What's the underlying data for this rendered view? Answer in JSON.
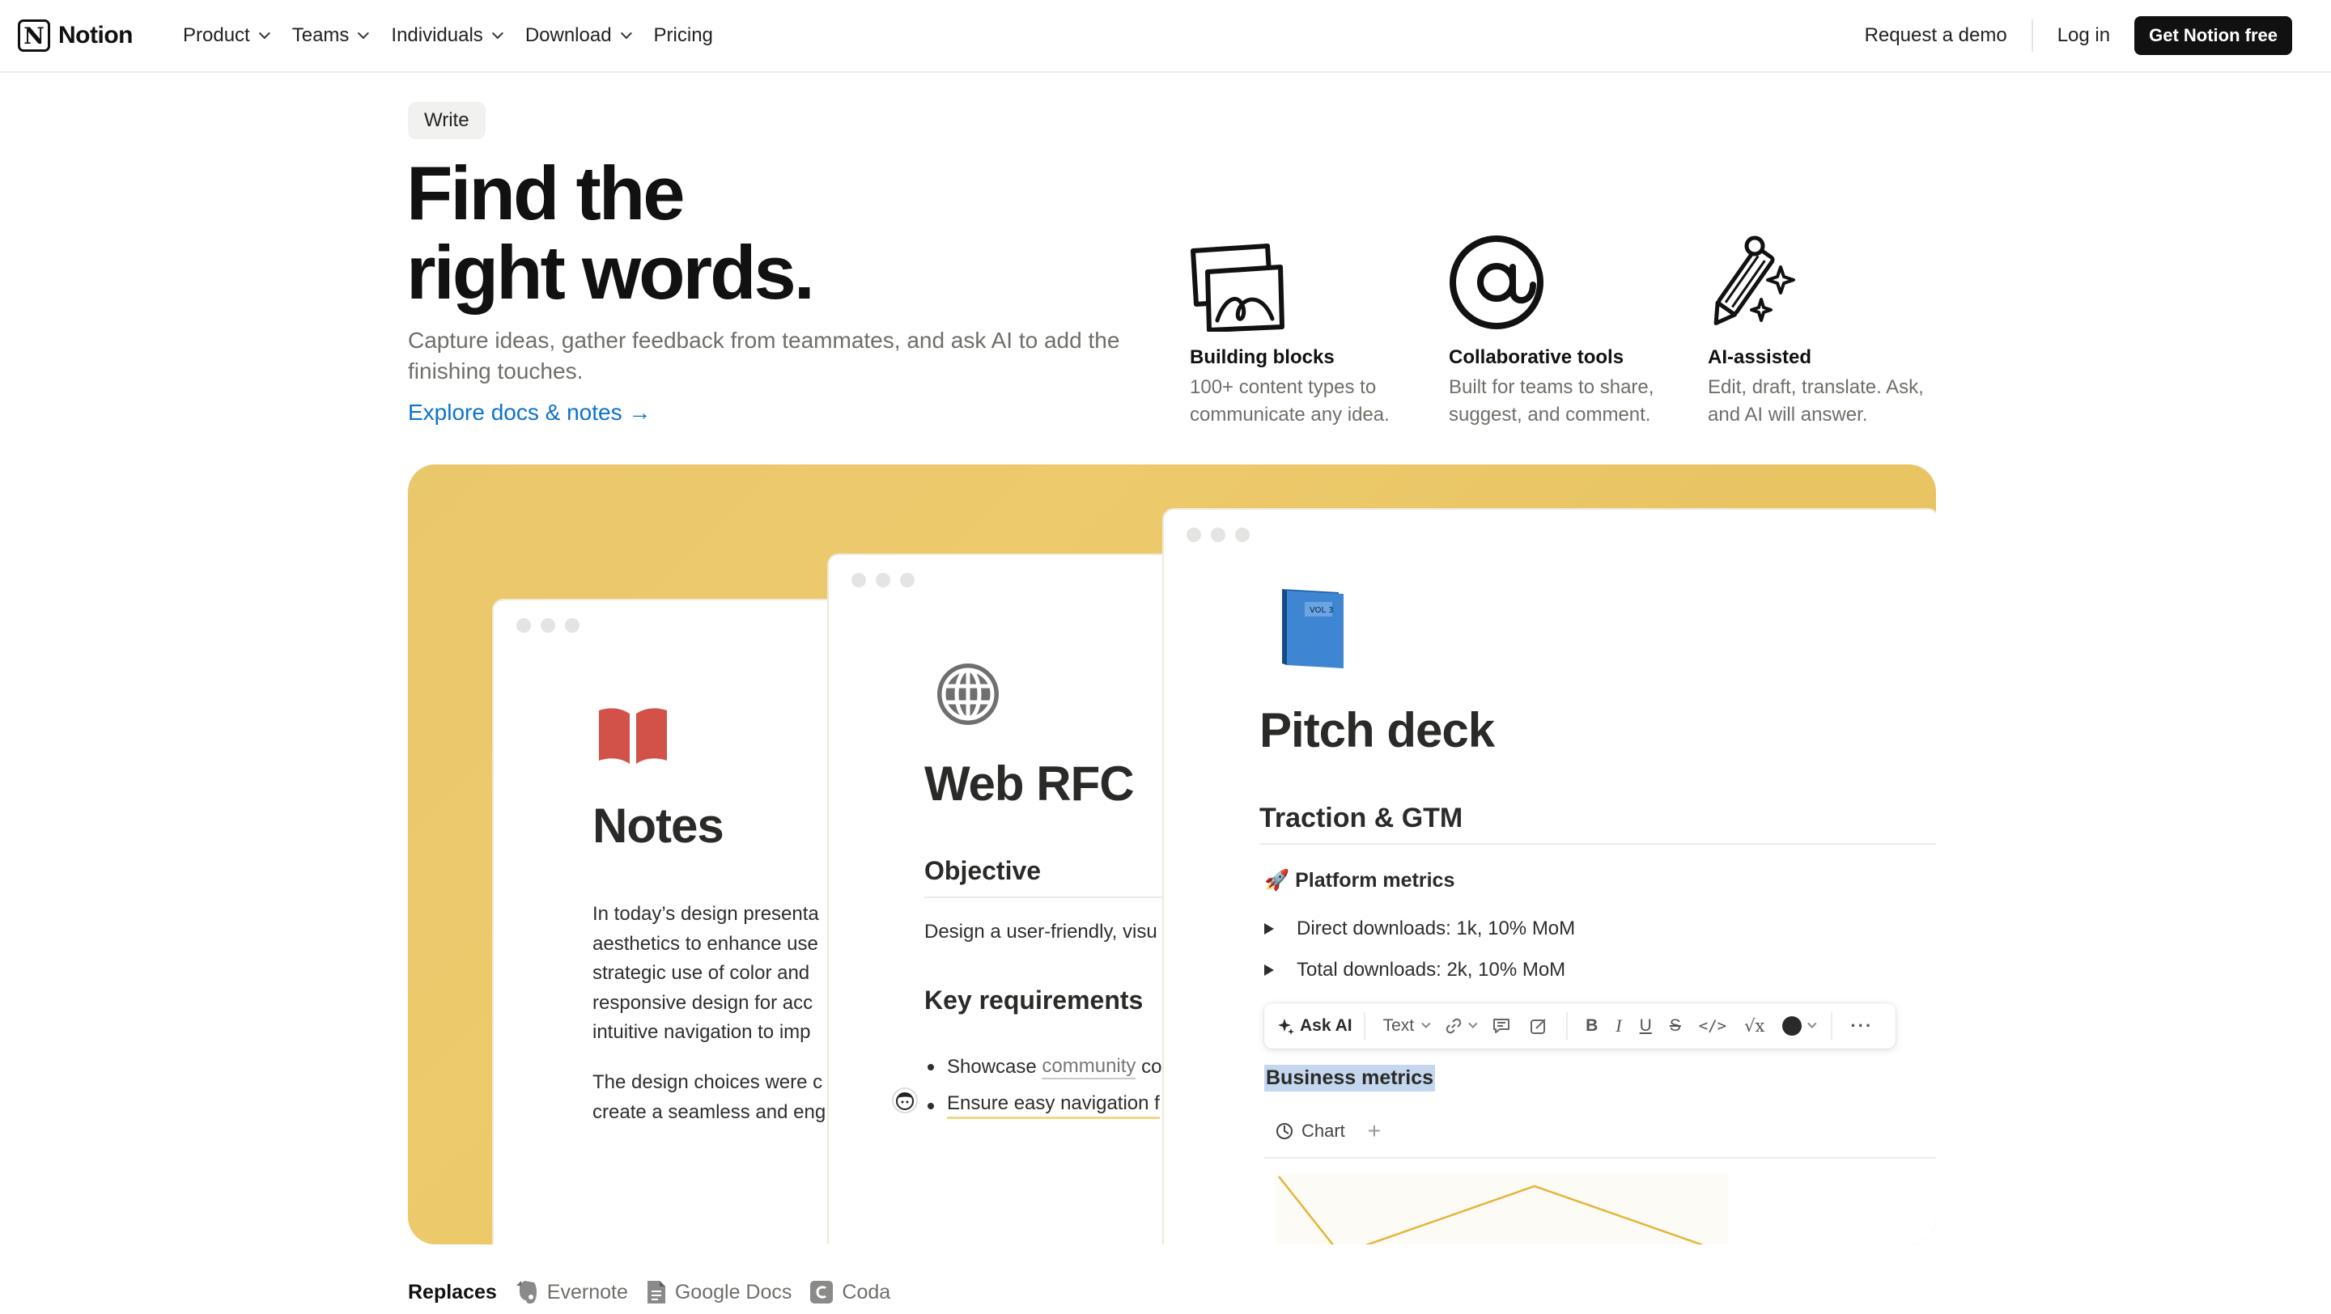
{
  "nav": {
    "brand": "Notion",
    "links": [
      "Product",
      "Teams",
      "Individuals",
      "Download",
      "Pricing"
    ],
    "request_demo": "Request a demo",
    "login": "Log in",
    "cta": "Get Notion free"
  },
  "hero": {
    "badge": "Write",
    "title_line1": "Find the",
    "title_line2": "right words.",
    "subtitle": "Capture ideas, gather feedback from teammates, and ask AI to add the finishing touches.",
    "explore_link": "Explore docs & notes →"
  },
  "features": [
    {
      "icon": "image-blocks-icon",
      "title": "Building blocks",
      "desc": "100+ content types to communicate any idea."
    },
    {
      "icon": "at-sign-icon",
      "title": "Collaborative tools",
      "desc": "Built for teams to share, suggest, and comment."
    },
    {
      "icon": "pencil-sparkle-icon",
      "title": "AI-assisted",
      "desc": "Edit, draft, translate. Ask, and AI will answer."
    }
  ],
  "cards": {
    "notes": {
      "icon": "red-book-icon",
      "title": "Notes",
      "para1": "In today's design presenta aesthetics to enhance use strategic use of color and responsive design for acc intuitive navigation to imp",
      "para1_lines": [
        "In today’s design presenta",
        "aesthetics to enhance use",
        "strategic use of color and",
        "responsive design for acc",
        "intuitive navigation to imp"
      ],
      "para2_lines": [
        "The design choices were c",
        "create a seamless and eng"
      ]
    },
    "rfc": {
      "icon": "globe-icon",
      "title": "Web RFC",
      "h_objective": "Objective",
      "objective_text": "Design a user-friendly, visu",
      "h_requirements": "Key requirements",
      "bullet1_prefix": "Showcase ",
      "bullet1_link": "community",
      "bullet1_suffix": " co",
      "bullet2": "Ensure easy navigation f"
    },
    "pitch": {
      "icon": "blue-book-icon",
      "title": "Pitch deck",
      "section": "Traction & GTM",
      "metrics_heading": "🚀 Platform metrics",
      "toggle1": "Direct downloads: 1k, 10% MoM",
      "toggle2": "Total downloads: 2k, 10% MoM",
      "toolbar": {
        "ask_ai": "Ask AI",
        "text": "Text"
      },
      "highlight": "Business metrics",
      "chart_tab": "Chart"
    }
  },
  "replaces": {
    "label": "Replaces",
    "items": [
      "Evernote",
      "Google Docs",
      "Coda"
    ]
  },
  "colors": {
    "link_blue": "#0a72d0",
    "stage_yellow": "#e9c76b",
    "notes_red": "#d2524a",
    "globe_gray": "#6f6f6f",
    "highlight_blue": "#c4d7ee",
    "chart_line": "#e3b53a"
  }
}
